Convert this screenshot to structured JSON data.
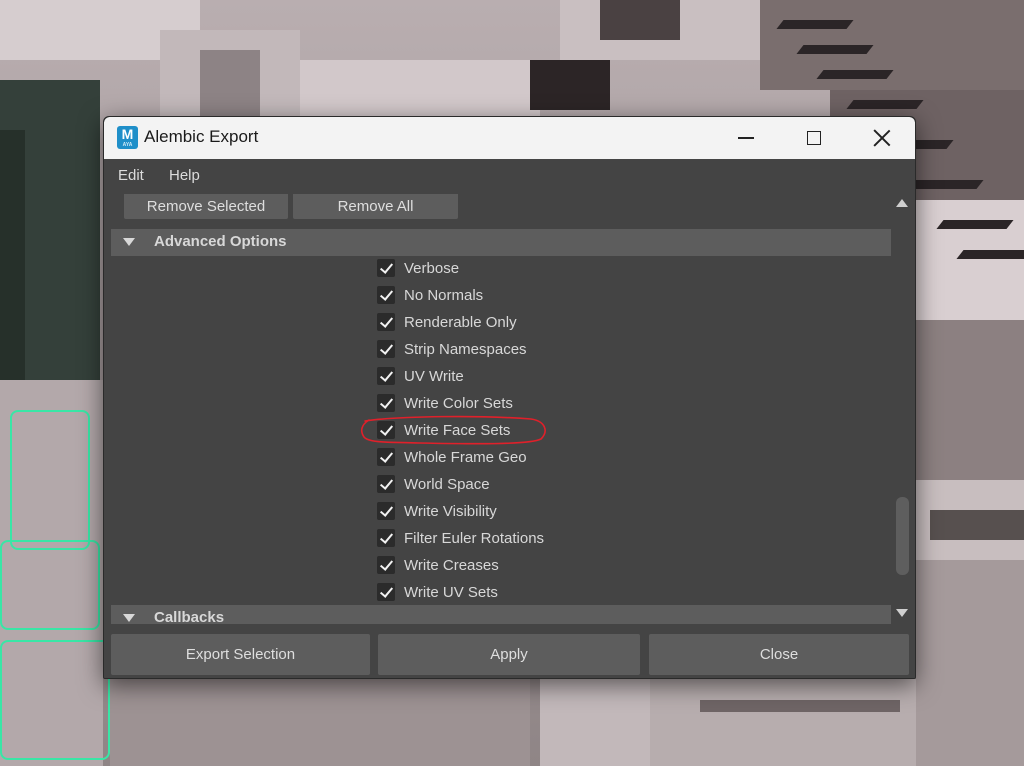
{
  "window": {
    "title": "Alembic Export",
    "app_icon": {
      "letter": "M",
      "sub": "AYA",
      "name": "maya-icon",
      "color": "#1f8fc9"
    },
    "controls": [
      "minimize-icon",
      "maximize-icon",
      "close-icon"
    ]
  },
  "menu": {
    "items": [
      "Edit",
      "Help"
    ]
  },
  "top_buttons": {
    "remove_selected": "Remove Selected",
    "remove_all": "Remove All"
  },
  "advanced": {
    "header": "Advanced Options",
    "options": [
      {
        "label": "Verbose",
        "checked": true
      },
      {
        "label": "No Normals",
        "checked": true
      },
      {
        "label": "Renderable Only",
        "checked": true
      },
      {
        "label": "Strip Namespaces",
        "checked": true
      },
      {
        "label": "UV Write",
        "checked": true
      },
      {
        "label": "Write Color Sets",
        "checked": true
      },
      {
        "label": "Write Face Sets",
        "checked": true,
        "highlighted": true
      },
      {
        "label": "Whole Frame Geo",
        "checked": true
      },
      {
        "label": "World Space",
        "checked": true
      },
      {
        "label": "Write Visibility",
        "checked": true
      },
      {
        "label": "Filter Euler Rotations",
        "checked": true
      },
      {
        "label": "Write Creases",
        "checked": true
      },
      {
        "label": "Write UV Sets",
        "checked": true
      }
    ]
  },
  "callbacks": {
    "header": "Callbacks"
  },
  "bottom_buttons": {
    "export_selection": "Export Selection",
    "apply": "Apply",
    "close": "Close"
  },
  "colors": {
    "panel": "#444444",
    "button": "#5d5d5d",
    "highlight_mark": "#e0202a",
    "text": "#d8d8d8"
  }
}
